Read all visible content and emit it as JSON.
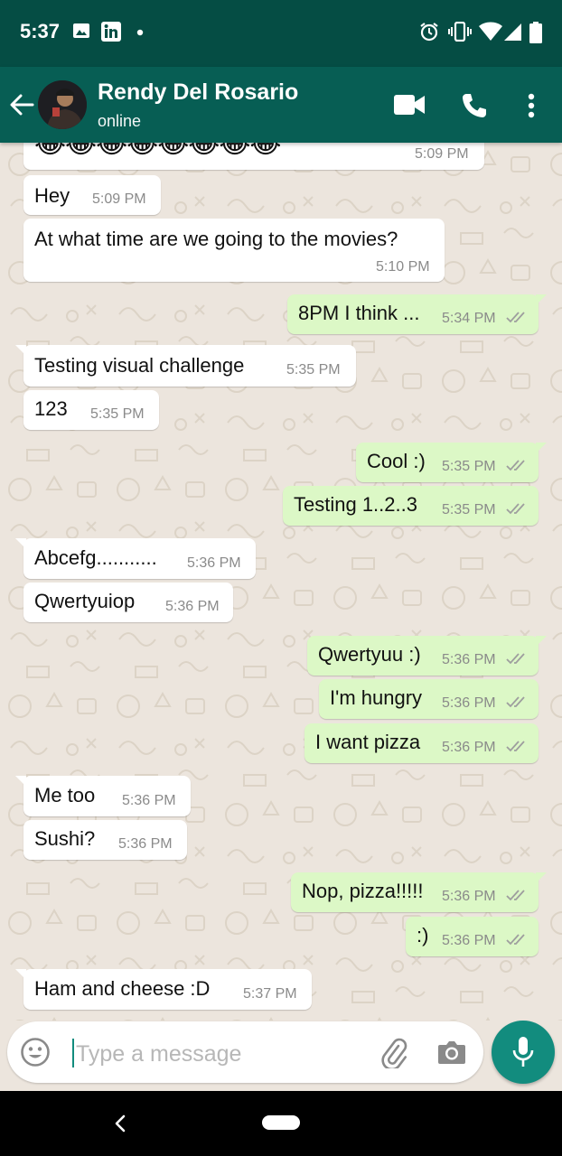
{
  "status_bar": {
    "time": "5:37",
    "icons_left": [
      "image-icon",
      "linkedin-icon",
      "dot-icon"
    ],
    "icons_right": [
      "alarm-icon",
      "vibrate-icon",
      "wifi-icon",
      "signal-icon",
      "battery-icon"
    ]
  },
  "header": {
    "contact_name": "Rendy Del Rosario",
    "status": "online",
    "actions": [
      "video-call-icon",
      "phone-icon",
      "more-vert-icon"
    ]
  },
  "messages": [
    {
      "dir": "in",
      "text": "😂😂😂😂😂😂😂😂",
      "time": "5:09 PM"
    },
    {
      "dir": "in",
      "text": "Hey",
      "time": "5:09 PM"
    },
    {
      "dir": "in",
      "text": "At what time are we going to the movies?",
      "time": "5:10 PM"
    },
    {
      "dir": "out",
      "text": "8PM I think ...",
      "time": "5:34 PM",
      "read": true
    },
    {
      "dir": "in",
      "text": "Testing visual challenge",
      "time": "5:35 PM"
    },
    {
      "dir": "in",
      "text": "123",
      "time": "5:35 PM"
    },
    {
      "dir": "out",
      "text": "Cool :)",
      "time": "5:35 PM",
      "read": true
    },
    {
      "dir": "out",
      "text": "Testing 1..2..3",
      "time": "5:35 PM",
      "read": true
    },
    {
      "dir": "in",
      "text": "Abcefg...........",
      "time": "5:36 PM"
    },
    {
      "dir": "in",
      "text": "Qwertyuiop",
      "time": "5:36 PM"
    },
    {
      "dir": "out",
      "text": "Qwertyuu :)",
      "time": "5:36 PM",
      "read": true
    },
    {
      "dir": "out",
      "text": "I'm hungry",
      "time": "5:36 PM",
      "read": true
    },
    {
      "dir": "out",
      "text": "I want pizza",
      "time": "5:36 PM",
      "read": true
    },
    {
      "dir": "in",
      "text": "Me too",
      "time": "5:36 PM"
    },
    {
      "dir": "in",
      "text": "Sushi?",
      "time": "5:36 PM"
    },
    {
      "dir": "out",
      "text": "Nop, pizza!!!!!",
      "time": "5:36 PM",
      "read": true
    },
    {
      "dir": "out",
      "text": ":)",
      "time": "5:36 PM",
      "read": true
    },
    {
      "dir": "in",
      "text": "Ham and cheese :D",
      "time": "5:37 PM"
    }
  ],
  "composer": {
    "placeholder": "Type a message",
    "icons": [
      "emoji-icon",
      "attach-icon",
      "camera-icon",
      "mic-icon"
    ]
  },
  "nav_bar": {
    "icons": [
      "back-nav-icon",
      "home-pill"
    ]
  },
  "colors": {
    "header": "#075e54",
    "status_bar": "#054d44",
    "outgoing_bubble": "#dcf8c6",
    "incoming_bubble": "#ffffff",
    "accent": "#128c7e",
    "read_ticks": "#9e9e9e"
  }
}
